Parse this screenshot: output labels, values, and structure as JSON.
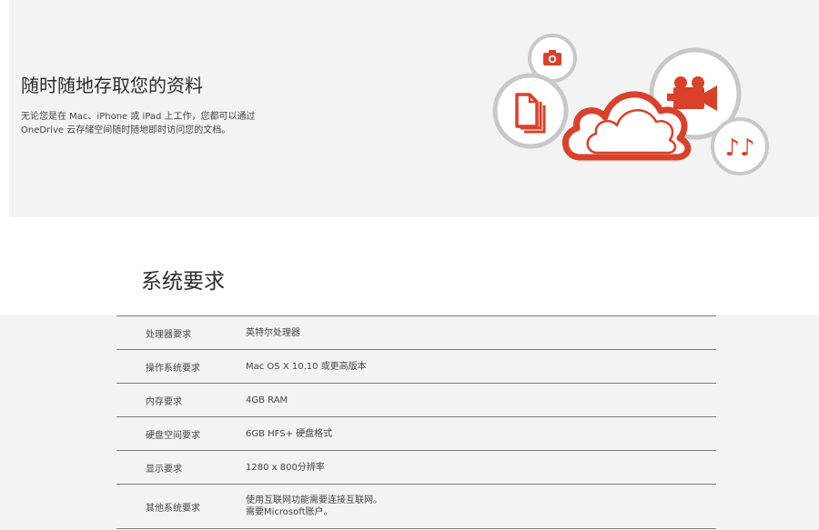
{
  "hero": {
    "title": "随时随地存取您的资料",
    "description": "无论您是在 Mac、iPhone 或 iPad 上工作，您都可以通过 OneDrive 云存储空间随时随地即时访问您的文档。",
    "icons": [
      "cloud-icon",
      "camera-icon",
      "documents-icon",
      "video-camera-icon",
      "music-notes-icon"
    ],
    "colors": {
      "accent": "#d9412b",
      "ring": "#c8c8c8",
      "background": "#f3f3f3"
    }
  },
  "specs": {
    "title": "系统要求",
    "rows": [
      {
        "label": "处理器要求",
        "value": "英特尔处理器"
      },
      {
        "label": "操作系统要求",
        "value": "Mac OS X 10.10 或更高版本"
      },
      {
        "label": "内存要求",
        "value": "4GB RAM"
      },
      {
        "label": "硬盘空间要求",
        "value": "6GB HFS+ 硬盘格式"
      },
      {
        "label": "显示要求",
        "value": "1280 x 800分辨率"
      },
      {
        "label": "其他系统要求",
        "value": "使用互联网功能需要连接互联网。",
        "value2": "需要Microsoft账户。"
      }
    ]
  }
}
